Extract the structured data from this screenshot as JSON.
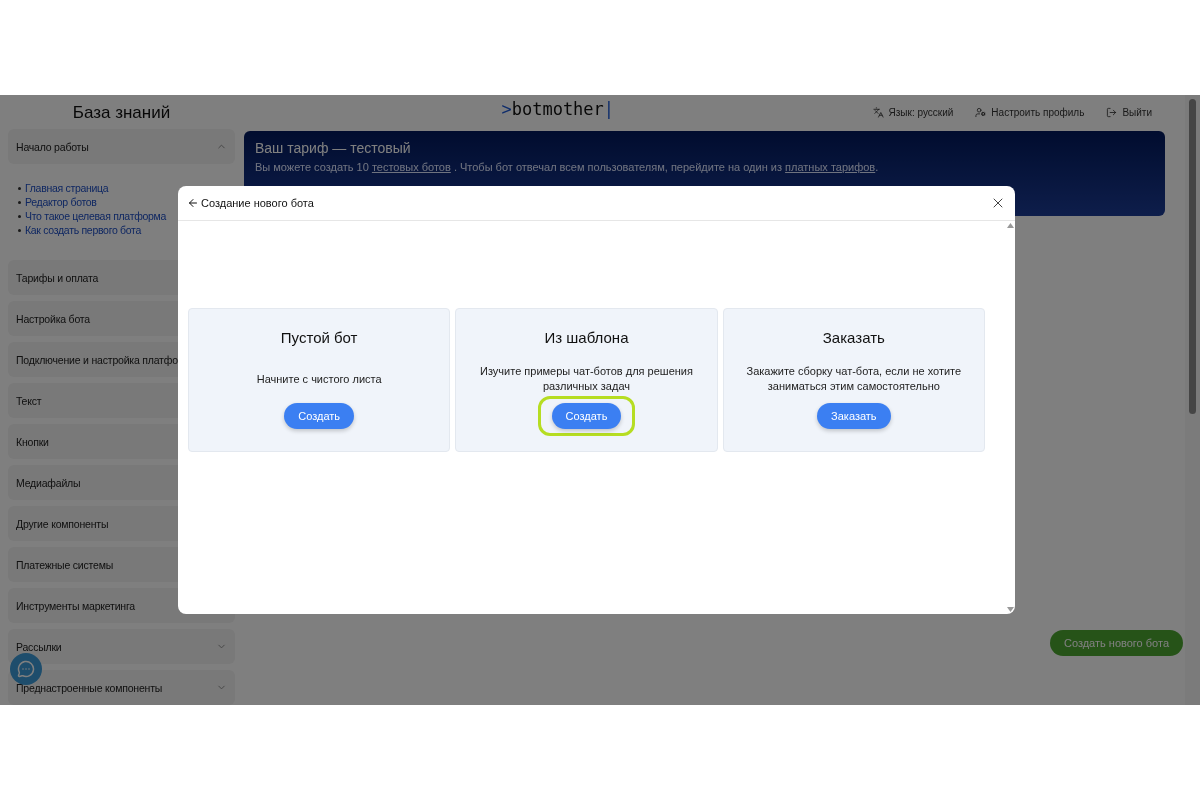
{
  "sidebar": {
    "title": "База знаний",
    "items": [
      {
        "label": "Начало работы",
        "kind": "collapsible",
        "expanded": true,
        "links": [
          "Главная страница",
          "Редактор ботов",
          "Что такое целевая платформа",
          "Как создать первого бота"
        ]
      },
      {
        "label": "Тарифы и оплата",
        "kind": "plain"
      },
      {
        "label": "Настройка бота",
        "kind": "plain"
      },
      {
        "label": "Подключение и настройка платфо",
        "kind": "plain"
      },
      {
        "label": "Текст",
        "kind": "plain"
      },
      {
        "label": "Кнопки",
        "kind": "plain"
      },
      {
        "label": "Медиафайлы",
        "kind": "plain"
      },
      {
        "label": "Другие компоненты",
        "kind": "plain"
      },
      {
        "label": "Платежные системы",
        "kind": "plain"
      },
      {
        "label": "Инструменты маркетинга",
        "kind": "plain"
      },
      {
        "label": "Рассылки",
        "kind": "collapsible",
        "expanded": false
      },
      {
        "label": "Преднастроенные компоненты",
        "kind": "collapsible",
        "expanded": false
      }
    ]
  },
  "header": {
    "logo": {
      "prefix": ">",
      "name": "botmother",
      "suffix": "|"
    },
    "nav": [
      {
        "label": "Язык: русский",
        "kind": "language"
      },
      {
        "label": "Настроить профиль",
        "kind": "profile"
      },
      {
        "label": "Выйти",
        "kind": "logout"
      }
    ]
  },
  "banner": {
    "title": "Ваш тариф — тестовый",
    "parts": [
      {
        "text": "Вы можете создать 10 ",
        "link": false
      },
      {
        "text": "тестовых ботов",
        "link": true
      },
      {
        "text": " . Чтобы бот отвечал всем пользователям, перейдите на один из ",
        "link": false
      },
      {
        "text": "платных тарифов",
        "link": true
      },
      {
        "text": ".",
        "link": false
      }
    ]
  },
  "fab": {
    "label": "Создать нового бота"
  },
  "modal": {
    "title": "Создание нового бота",
    "cards": [
      {
        "title": "Пустой бот",
        "text": "Начните с чистого листа",
        "button": "Создать",
        "highlighted": false
      },
      {
        "title": "Из шаблона",
        "text": "Изучите примеры чат-ботов для решения различных задач",
        "button": "Создать",
        "highlighted": true
      },
      {
        "title": "Заказать",
        "text": "Закажите сборку чат-бота, если не хотите заниматься этим самостоятельно",
        "button": "Заказать",
        "highlighted": false
      }
    ]
  }
}
